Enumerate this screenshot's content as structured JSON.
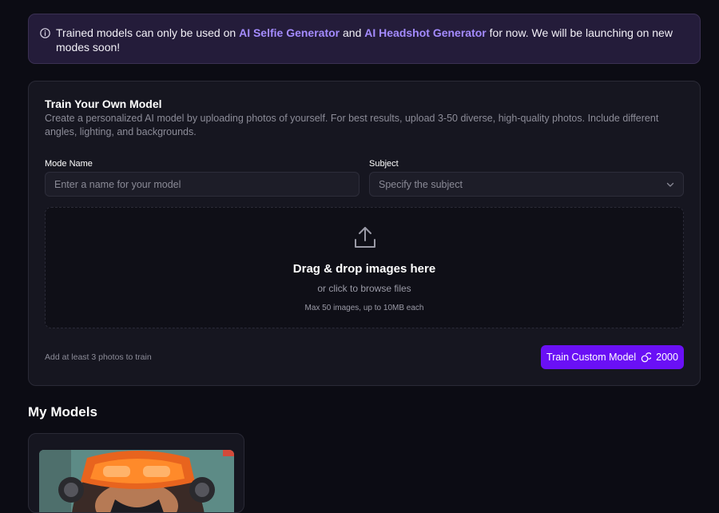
{
  "notice": {
    "before": "Trained models can only be used on ",
    "link1": "AI Selfie Generator",
    "middle": " and ",
    "link2": "AI Headshot Generator",
    "after": " for now. We will be launching on new modes soon!"
  },
  "train": {
    "title": "Train Your Own Model",
    "description": "Create a personalized AI model by uploading photos of yourself. For best results, upload 3-50 diverse, high-quality photos. Include different angles, lighting, and backgrounds.",
    "model_name_label": "Mode Name",
    "model_name_placeholder": "Enter a name for your model",
    "subject_label": "Subject",
    "subject_placeholder": "Specify the subject",
    "dropzone_title": "Drag & drop images here",
    "dropzone_sub": "or click to browse files",
    "dropzone_limit": "Max 50 images, up to 10MB each",
    "hint": "Add at least 3 photos to train",
    "button_label": "Train Custom Model",
    "button_cost": "2000"
  },
  "models": {
    "title": "My Models"
  },
  "colors": {
    "accent": "#6a10f5",
    "link": "#a48bff",
    "background": "#0c0c14"
  }
}
